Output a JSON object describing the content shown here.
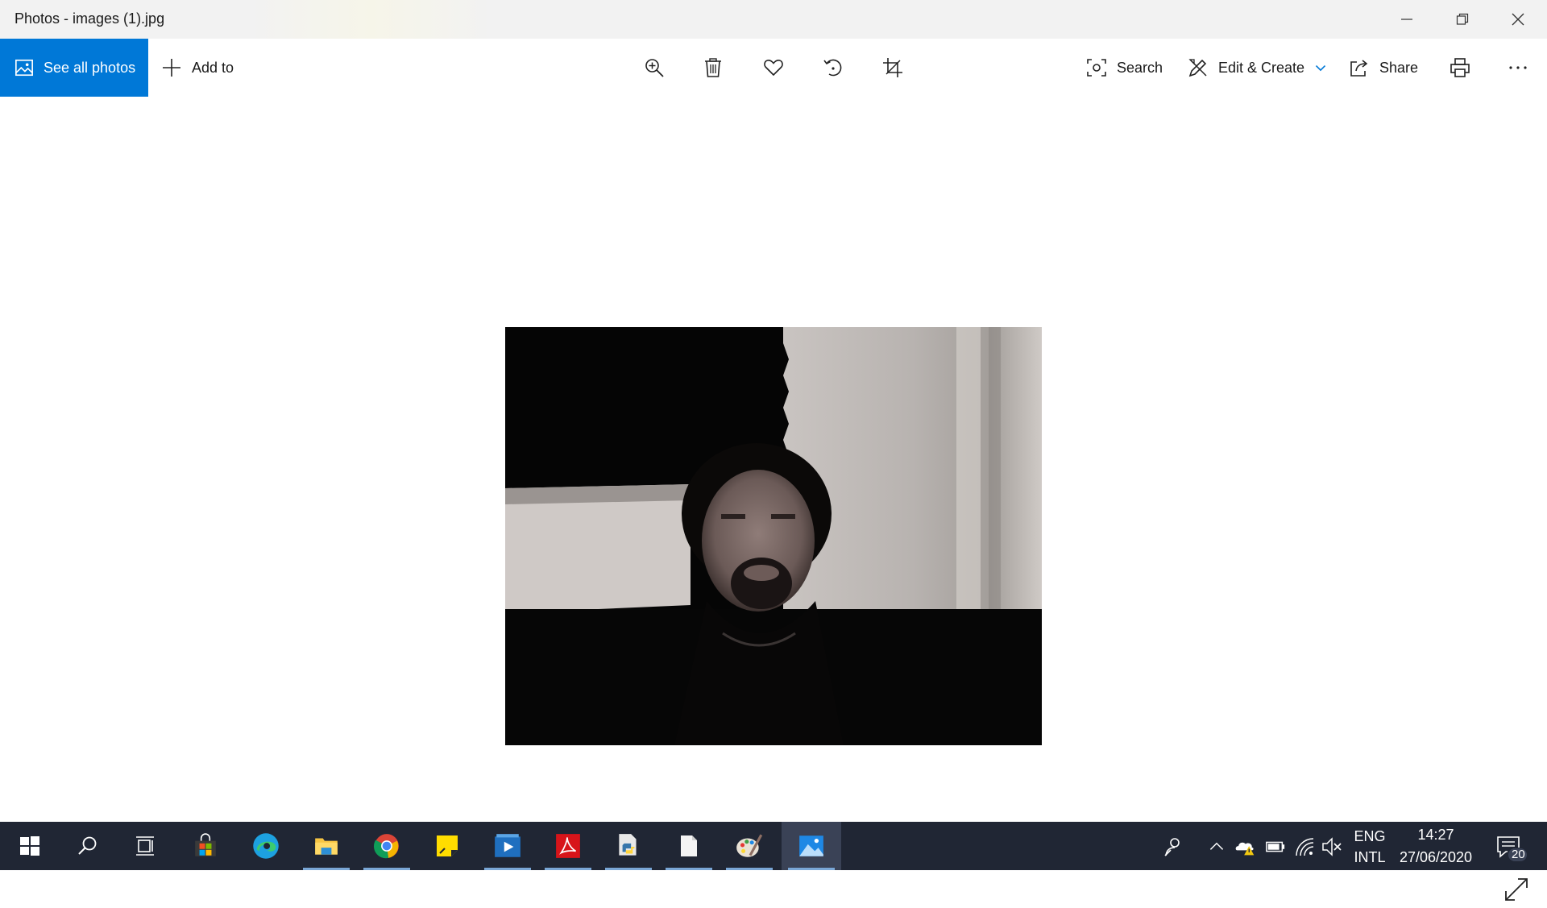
{
  "window": {
    "title": "Photos - images (1).jpg",
    "controls": [
      "minimize-icon",
      "restore-icon",
      "close-icon"
    ]
  },
  "toolbar": {
    "see_all_label": "See all photos",
    "add_to_label": "Add to",
    "search_label": "Search",
    "edit_create_label": "Edit & Create",
    "share_label": "Share",
    "icons": [
      "zoom-in-icon",
      "delete-icon",
      "favorite-icon",
      "rotate-icon",
      "crop-icon",
      "print-icon",
      "more-icon"
    ]
  },
  "taskbar": {
    "apps": [
      "start-icon",
      "search-icon",
      "task-view-icon",
      "store-icon",
      "edge-icon",
      "file-explorer-icon",
      "chrome-icon",
      "sticky-notes-icon",
      "media-player-icon",
      "acrobat-icon",
      "python-icon",
      "notepad-icon",
      "paint-icon",
      "photos-icon"
    ],
    "tray": {
      "language_line1": "ENG",
      "language_line2": "INTL",
      "time": "14:27",
      "date": "27/06/2020",
      "notification_count": "20"
    }
  },
  "colors": {
    "accent": "#0078d7",
    "taskbar": "#202634"
  }
}
